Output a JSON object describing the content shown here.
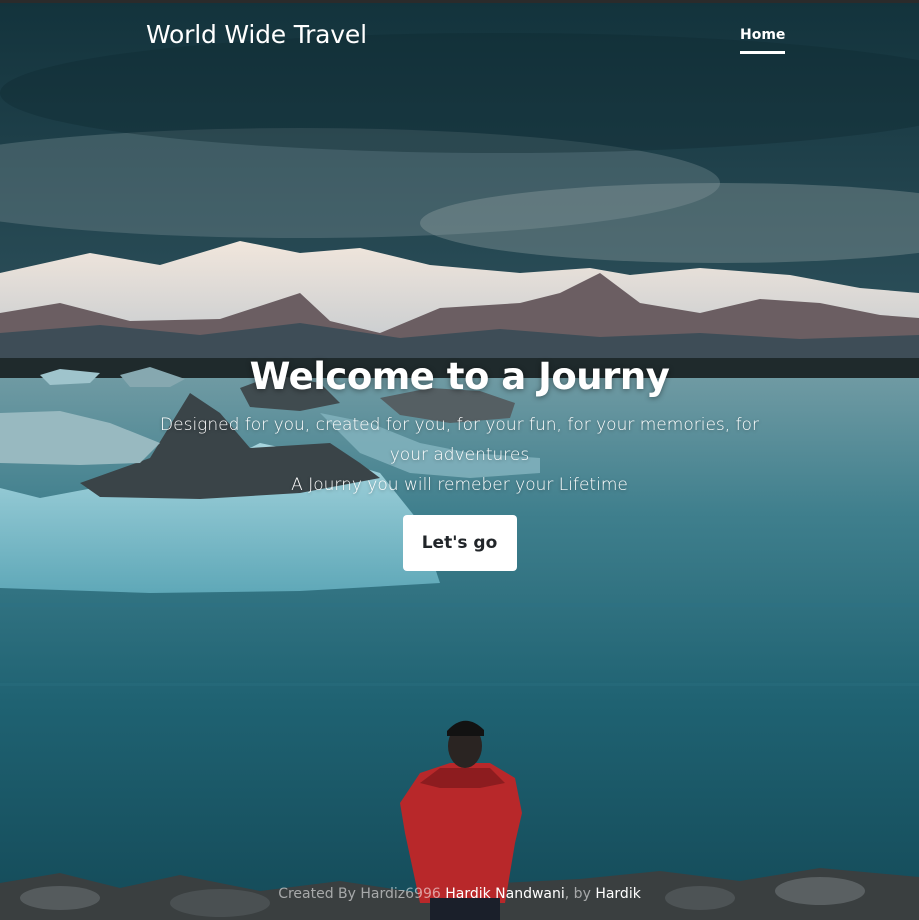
{
  "nav": {
    "brand": "World Wide Travel",
    "home_label": "Home"
  },
  "hero": {
    "title": "Welcome to a Journy",
    "line1": "Designed for you, created for you, for your fun, for your memories, for your adventures",
    "line2": "A Journy you will remeber your Lifetime",
    "button_label": "Let's go"
  },
  "footer": {
    "prefix": "Created By Hardiz6996",
    "author_link": "Hardik Nandwani",
    "separator": ", by",
    "by_link": "Hardik"
  },
  "colors": {
    "sky": "#2a4a55",
    "water": "#1d5b6a",
    "jacket": "#b8282a",
    "button_bg": "#ffffff"
  }
}
